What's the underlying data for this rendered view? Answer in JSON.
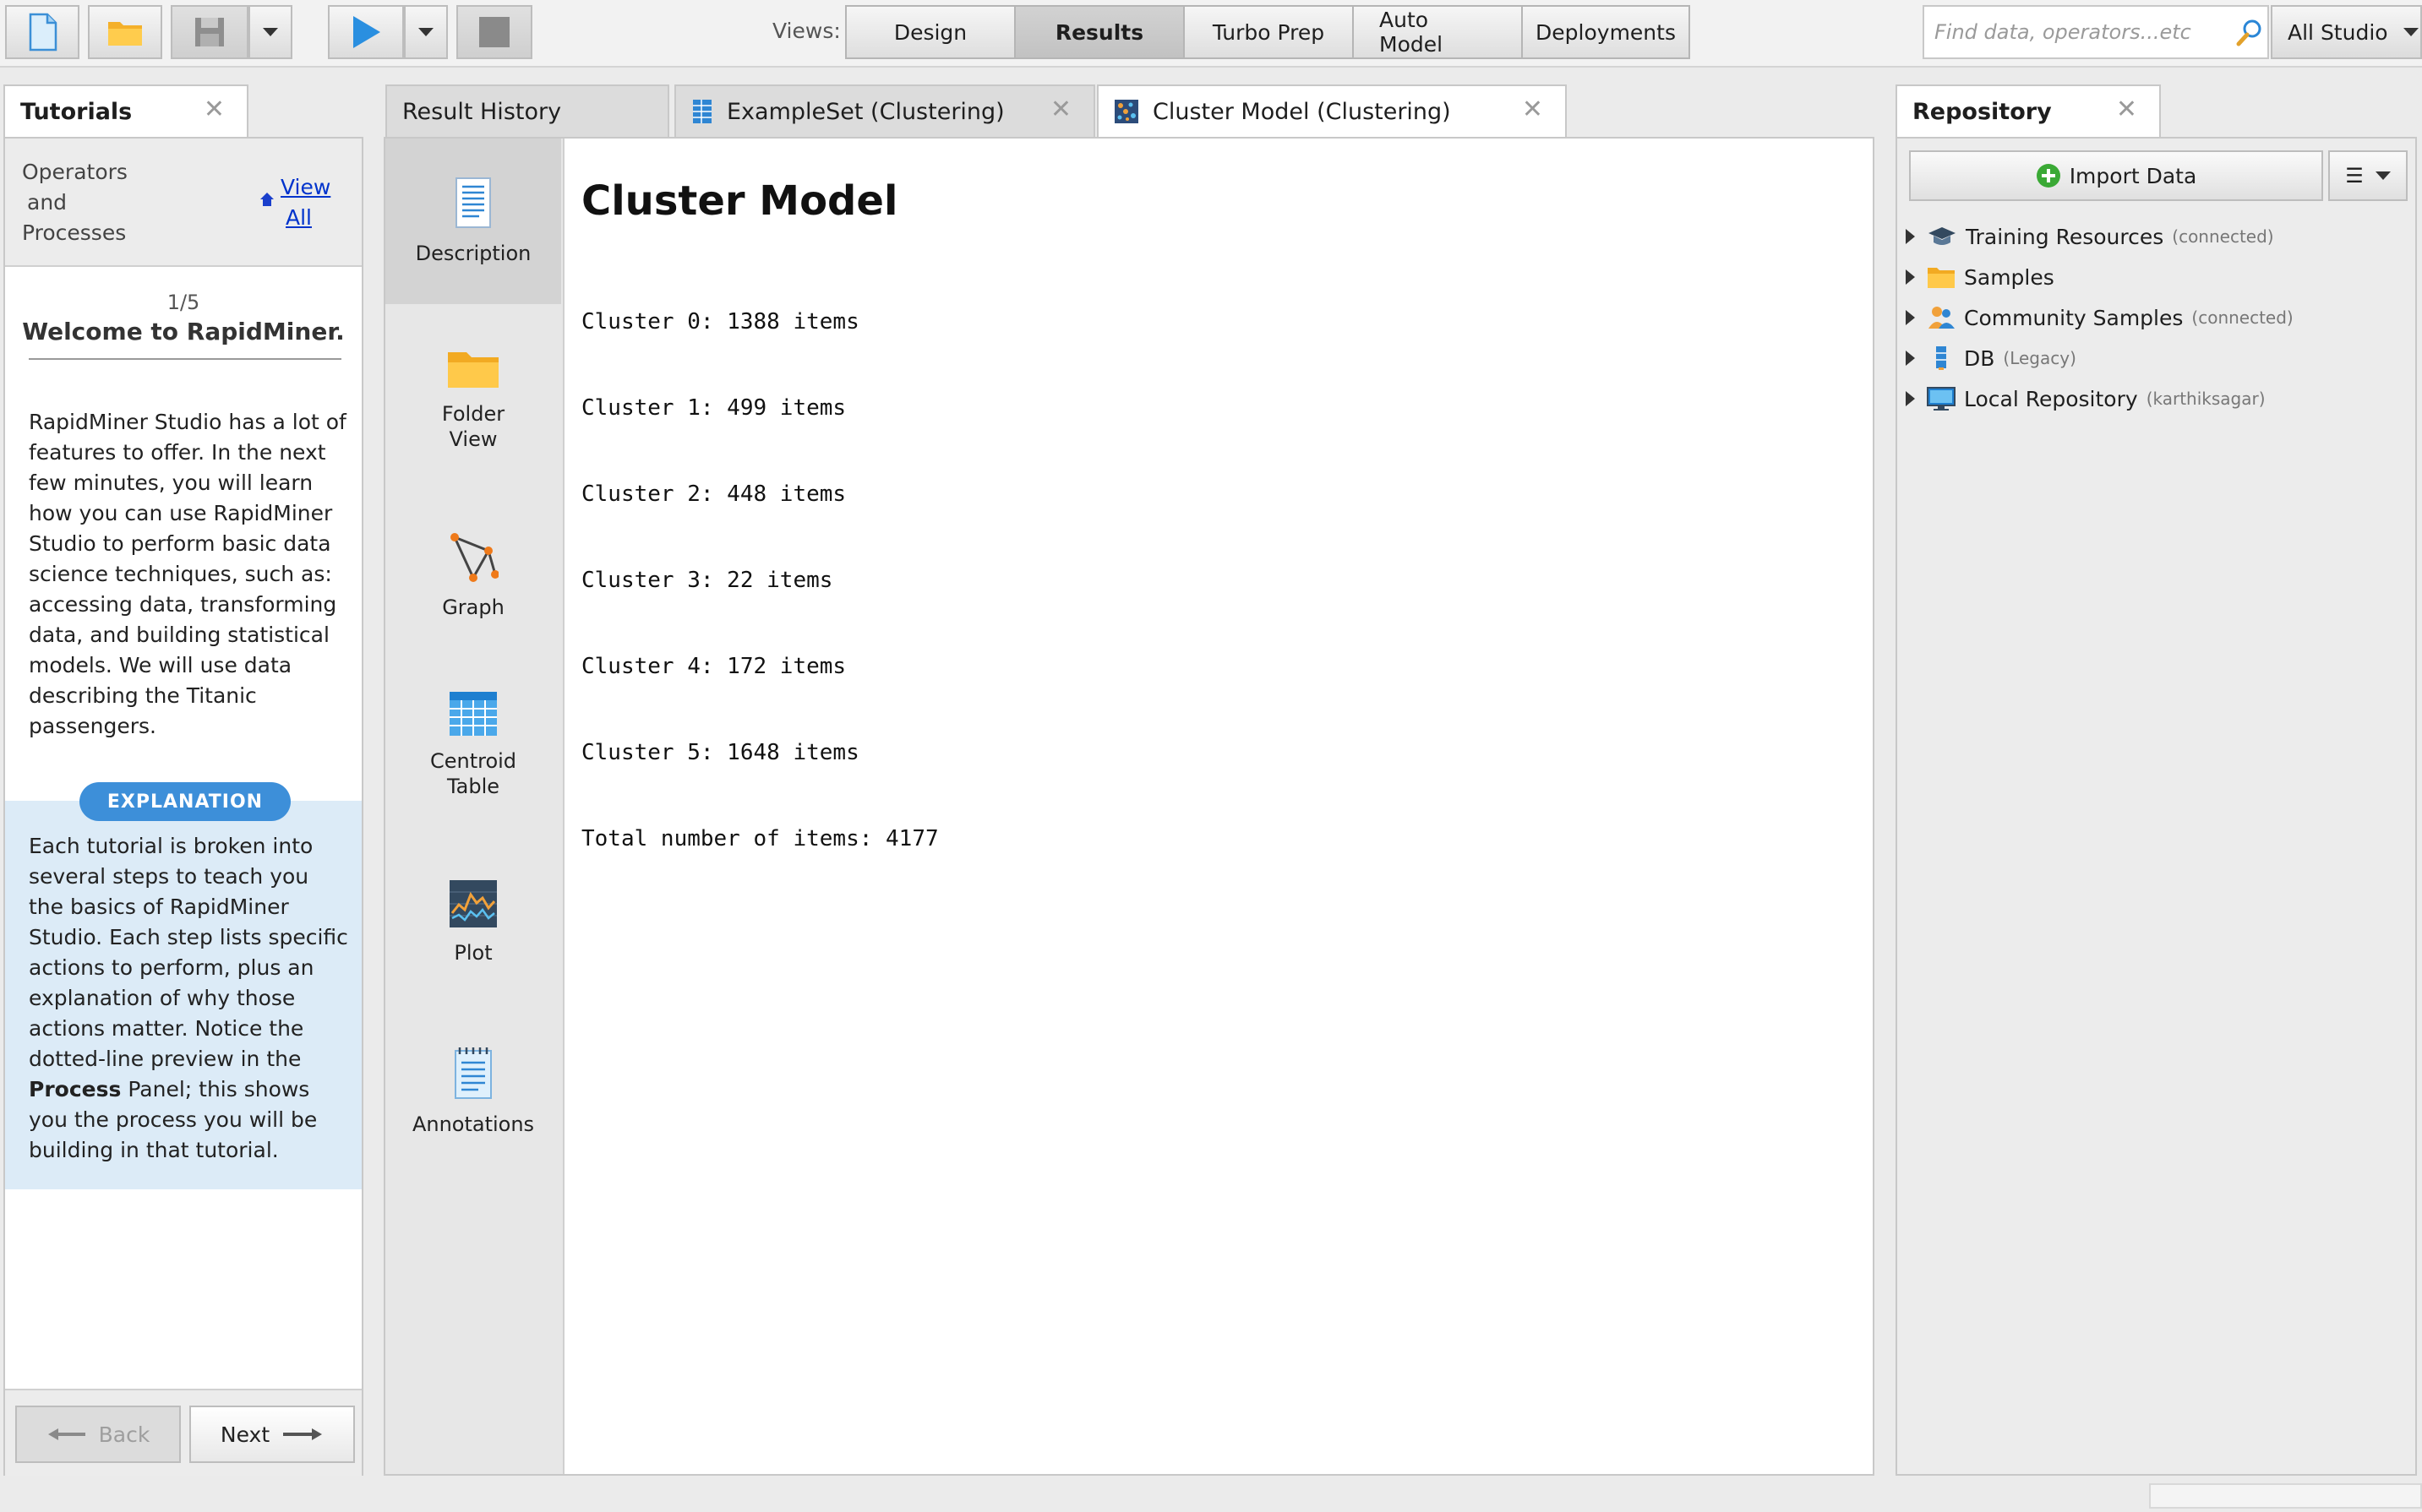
{
  "toolbar": {
    "views_label": "Views:",
    "views": [
      "Design",
      "Results",
      "Turbo Prep",
      "Auto Model",
      "Deployments"
    ],
    "active_view": "Results",
    "search_placeholder": "Find data, operators...etc",
    "scope": "All Studio"
  },
  "tutorials": {
    "tab_title": "Tutorials",
    "breadcrumb": [
      "Operators",
      "and",
      "Processes"
    ],
    "view_all": [
      "View",
      "All"
    ],
    "step": "1/5",
    "title": "Welcome to RapidMiner.",
    "body": "RapidMiner Studio has a lot of features to offer. In the next few minutes, you will learn how you can use RapidMiner Studio to perform basic data science techniques, such as: accessing data, transforming data, and building statistical models. We will use data describing the Titanic passengers.",
    "explanation_label": "EXPLANATION",
    "explanation_part1": "Each tutorial is broken into several steps to teach you the basics of RapidMiner Studio. Each step lists specific actions to perform, plus an explanation of why those actions matter. Notice the dotted-line preview in the ",
    "explanation_bold": "Process",
    "explanation_part2": " Panel; this shows you the process you will be building in that tutorial.",
    "back_label": "Back",
    "next_label": "Next"
  },
  "results": {
    "tabs": [
      "Result History",
      "ExampleSet (Clustering)",
      "Cluster Model (Clustering)"
    ],
    "active_tab": "Cluster Model (Clustering)",
    "nav": [
      "Description",
      "Folder View",
      "Graph",
      "Centroid Table",
      "Plot",
      "Annotations"
    ],
    "active_nav": "Description",
    "title": "Cluster Model",
    "lines": [
      "Cluster 0: 1388 items",
      "Cluster 1: 499 items",
      "Cluster 2: 448 items",
      "Cluster 3: 22 items",
      "Cluster 4: 172 items",
      "Cluster 5: 1648 items",
      "Total number of items: 4177"
    ]
  },
  "repository": {
    "tab_title": "Repository",
    "import_label": "Import Data",
    "items": [
      {
        "label": "Training Resources",
        "note": "(connected)",
        "icon": "graduation-cap-icon"
      },
      {
        "label": "Samples",
        "note": "",
        "icon": "folder-icon"
      },
      {
        "label": "Community Samples",
        "note": "(connected)",
        "icon": "people-icon"
      },
      {
        "label": "DB",
        "note": "(Legacy)",
        "icon": "database-icon"
      },
      {
        "label": "Local Repository",
        "note": "(karthiksagar)",
        "icon": "monitor-icon"
      }
    ]
  },
  "colors": {
    "accent": "#3d8fd9",
    "play": "#2a8fe0",
    "folder": "#f6b32b",
    "link": "#0033cc",
    "import_plus": "#3aa935"
  }
}
